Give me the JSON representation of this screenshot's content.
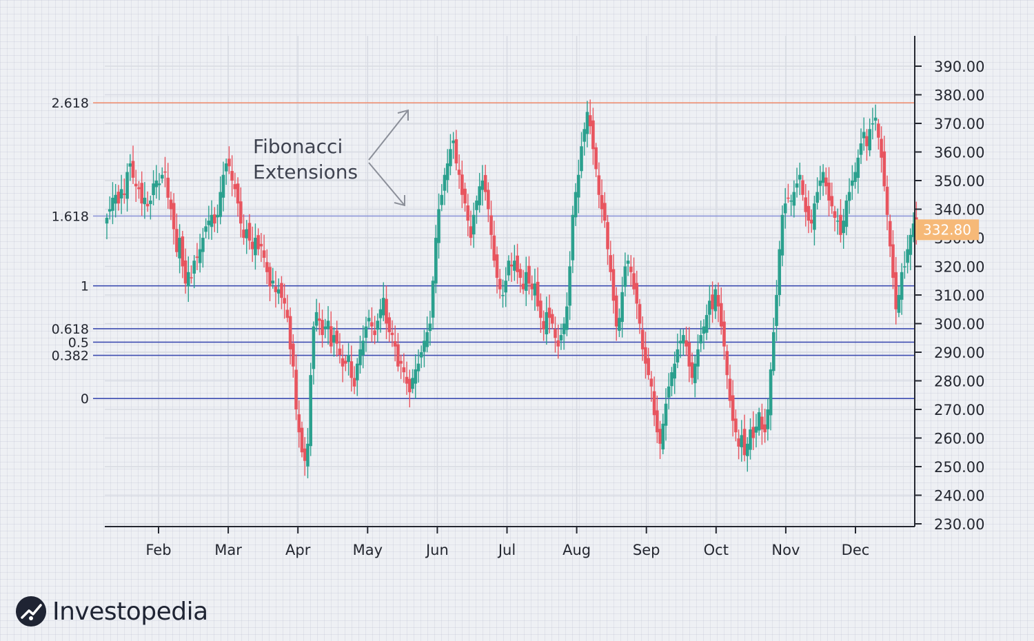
{
  "chart_data": {
    "type": "candlestick",
    "months": [
      "Feb",
      "Mar",
      "Apr",
      "May",
      "Jun",
      "Jul",
      "Aug",
      "Sep",
      "Oct",
      "Nov",
      "Dec"
    ],
    "yticks": [
      "390.00",
      "380.00",
      "370.00",
      "360.00",
      "350.00",
      "340.00",
      "330.00",
      "320.00",
      "310.00",
      "300.00",
      "290.00",
      "280.00",
      "270.00",
      "260.00",
      "250.00",
      "240.00",
      "230.00"
    ],
    "ylim": [
      228,
      395
    ],
    "last_price": "332.80",
    "last_price_value": 332.8,
    "fib_levels": [
      {
        "label": "2.618",
        "value": 377.2,
        "color": "#f0896a"
      },
      {
        "label": "1.618",
        "value": 337.6,
        "color": "#8c95d8"
      },
      {
        "label": "1",
        "value": 313.2,
        "color": "#3c4bb0"
      },
      {
        "label": "0.618",
        "value": 298.2,
        "color": "#3c4bb0"
      },
      {
        "label": "0.5",
        "value": 293.5,
        "color": "#3c4bb0"
      },
      {
        "label": "0.382",
        "value": 288.9,
        "color": "#3c4bb0"
      },
      {
        "label": "0",
        "value": 273.8,
        "color": "#3c4bb0"
      }
    ],
    "annotation": [
      "Fibonacci",
      "Extensions"
    ],
    "colors": {
      "up": "#2ba08e",
      "down": "#e8555f",
      "price_tag": "#f6b978",
      "axis": "#23262f",
      "grid": "#d7dae2"
    },
    "closes": [
      [
        0,
        337
      ],
      [
        3,
        340
      ],
      [
        6,
        344
      ],
      [
        9,
        345
      ],
      [
        12,
        342
      ],
      [
        15,
        347
      ],
      [
        18,
        345
      ],
      [
        21,
        353
      ],
      [
        24,
        356
      ],
      [
        27,
        351
      ],
      [
        30,
        348
      ],
      [
        33,
        347
      ],
      [
        36,
        342
      ],
      [
        39,
        344
      ],
      [
        42,
        341
      ],
      [
        45,
        343
      ],
      [
        48,
        349
      ],
      [
        51,
        350
      ],
      [
        54,
        349
      ],
      [
        57,
        352
      ],
      [
        60,
        353
      ],
      [
        63,
        344
      ],
      [
        66,
        340
      ],
      [
        69,
        333
      ],
      [
        72,
        325
      ],
      [
        75,
        330
      ],
      [
        78,
        320
      ],
      [
        81,
        314
      ],
      [
        84,
        318
      ],
      [
        87,
        316
      ],
      [
        90,
        322
      ],
      [
        93,
        323
      ],
      [
        96,
        326
      ],
      [
        99,
        330
      ],
      [
        102,
        334
      ],
      [
        105,
        336
      ],
      [
        108,
        338
      ],
      [
        111,
        335
      ],
      [
        114,
        338
      ],
      [
        117,
        346
      ],
      [
        120,
        352
      ],
      [
        123,
        356
      ],
      [
        126,
        355
      ],
      [
        129,
        350
      ],
      [
        132,
        347
      ],
      [
        135,
        342
      ],
      [
        138,
        335
      ],
      [
        141,
        330
      ],
      [
        144,
        333
      ],
      [
        147,
        329
      ],
      [
        150,
        326
      ],
      [
        153,
        330
      ],
      [
        156,
        326
      ],
      [
        159,
        327
      ],
      [
        162,
        323
      ],
      [
        165,
        318
      ],
      [
        168,
        313
      ],
      [
        171,
        315
      ],
      [
        174,
        311
      ],
      [
        177,
        312
      ],
      [
        180,
        309
      ],
      [
        183,
        307
      ],
      [
        186,
        302
      ],
      [
        189,
        291
      ],
      [
        192,
        285
      ],
      [
        195,
        270
      ],
      [
        198,
        262
      ],
      [
        201,
        255
      ],
      [
        204,
        252
      ],
      [
        207,
        258
      ],
      [
        210,
        282
      ],
      [
        213,
        299
      ],
      [
        216,
        304
      ],
      [
        219,
        301
      ],
      [
        222,
        296
      ],
      [
        225,
        299
      ],
      [
        228,
        301
      ],
      [
        231,
        292
      ],
      [
        234,
        296
      ],
      [
        237,
        293
      ],
      [
        240,
        289
      ],
      [
        243,
        285
      ],
      [
        246,
        286
      ],
      [
        249,
        289
      ],
      [
        252,
        281
      ],
      [
        255,
        278
      ],
      [
        258,
        286
      ],
      [
        261,
        291
      ],
      [
        264,
        294
      ],
      [
        267,
        299
      ],
      [
        270,
        302
      ],
      [
        273,
        299
      ],
      [
        276,
        296
      ],
      [
        279,
        301
      ],
      [
        282,
        305
      ],
      [
        285,
        309
      ],
      [
        288,
        300
      ],
      [
        291,
        297
      ],
      [
        294,
        296
      ],
      [
        297,
        292
      ],
      [
        300,
        285
      ],
      [
        303,
        286
      ],
      [
        306,
        283
      ],
      [
        309,
        279
      ],
      [
        312,
        276
      ],
      [
        315,
        281
      ],
      [
        318,
        284
      ],
      [
        321,
        286
      ],
      [
        324,
        290
      ],
      [
        327,
        294
      ],
      [
        330,
        297
      ],
      [
        333,
        300
      ],
      [
        336,
        315
      ],
      [
        339,
        330
      ],
      [
        342,
        340
      ],
      [
        345,
        345
      ],
      [
        348,
        352
      ],
      [
        351,
        356
      ],
      [
        354,
        361
      ],
      [
        357,
        364
      ],
      [
        360,
        356
      ],
      [
        363,
        352
      ],
      [
        366,
        345
      ],
      [
        369,
        342
      ],
      [
        372,
        336
      ],
      [
        375,
        330
      ],
      [
        378,
        338
      ],
      [
        381,
        343
      ],
      [
        384,
        348
      ],
      [
        387,
        350
      ],
      [
        390,
        346
      ],
      [
        393,
        340
      ],
      [
        396,
        331
      ],
      [
        399,
        322
      ],
      [
        402,
        316
      ],
      [
        405,
        312
      ],
      [
        408,
        310
      ],
      [
        411,
        315
      ],
      [
        414,
        322
      ],
      [
        417,
        320
      ],
      [
        420,
        322
      ],
      [
        423,
        318
      ],
      [
        426,
        316
      ],
      [
        429,
        312
      ],
      [
        432,
        318
      ],
      [
        435,
        314
      ],
      [
        438,
        312
      ],
      [
        441,
        314
      ],
      [
        444,
        306
      ],
      [
        447,
        302
      ],
      [
        450,
        298
      ],
      [
        453,
        304
      ],
      [
        456,
        302
      ],
      [
        459,
        300
      ],
      [
        462,
        295
      ],
      [
        465,
        292
      ],
      [
        468,
        296
      ],
      [
        471,
        300
      ],
      [
        474,
        306
      ],
      [
        477,
        320
      ],
      [
        480,
        338
      ],
      [
        483,
        346
      ],
      [
        486,
        352
      ],
      [
        489,
        362
      ],
      [
        492,
        368
      ],
      [
        495,
        374
      ],
      [
        498,
        369
      ],
      [
        501,
        361
      ],
      [
        504,
        354
      ],
      [
        507,
        345
      ],
      [
        510,
        340
      ],
      [
        513,
        336
      ],
      [
        516,
        326
      ],
      [
        519,
        318
      ],
      [
        522,
        308
      ],
      [
        525,
        299
      ],
      [
        528,
        302
      ],
      [
        531,
        311
      ],
      [
        534,
        320
      ],
      [
        537,
        322
      ],
      [
        540,
        318
      ],
      [
        543,
        312
      ],
      [
        546,
        307
      ],
      [
        549,
        300
      ],
      [
        552,
        291
      ],
      [
        555,
        286
      ],
      [
        558,
        282
      ],
      [
        561,
        278
      ],
      [
        564,
        268
      ],
      [
        567,
        262
      ],
      [
        570,
        258
      ],
      [
        573,
        265
      ],
      [
        576,
        272
      ],
      [
        579,
        278
      ],
      [
        582,
        283
      ],
      [
        585,
        286
      ],
      [
        588,
        291
      ],
      [
        591,
        294
      ],
      [
        594,
        296
      ],
      [
        597,
        292
      ],
      [
        600,
        285
      ],
      [
        603,
        281
      ],
      [
        606,
        286
      ],
      [
        609,
        291
      ],
      [
        612,
        296
      ],
      [
        615,
        299
      ],
      [
        618,
        303
      ],
      [
        621,
        308
      ],
      [
        624,
        305
      ],
      [
        627,
        312
      ],
      [
        630,
        306
      ],
      [
        633,
        299
      ],
      [
        636,
        292
      ],
      [
        639,
        282
      ],
      [
        642,
        273
      ],
      [
        645,
        266
      ],
      [
        648,
        262
      ],
      [
        651,
        257
      ],
      [
        654,
        261
      ],
      [
        657,
        254
      ],
      [
        660,
        258
      ],
      [
        663,
        263
      ],
      [
        666,
        260
      ],
      [
        669,
        264
      ],
      [
        672,
        269
      ],
      [
        675,
        263
      ],
      [
        678,
        262
      ],
      [
        681,
        270
      ],
      [
        684,
        284
      ],
      [
        687,
        297
      ],
      [
        690,
        310
      ],
      [
        693,
        326
      ],
      [
        696,
        338
      ],
      [
        699,
        342
      ],
      [
        702,
        344
      ],
      [
        705,
        343
      ],
      [
        708,
        346
      ],
      [
        711,
        349
      ],
      [
        714,
        352
      ],
      [
        717,
        345
      ],
      [
        720,
        339
      ],
      [
        723,
        336
      ],
      [
        726,
        335
      ],
      [
        729,
        342
      ],
      [
        732,
        346
      ],
      [
        735,
        350
      ],
      [
        738,
        353
      ],
      [
        741,
        348
      ],
      [
        744,
        343
      ],
      [
        747,
        341
      ],
      [
        750,
        337
      ],
      [
        753,
        336
      ],
      [
        756,
        331
      ],
      [
        759,
        336
      ],
      [
        762,
        343
      ],
      [
        765,
        346
      ],
      [
        768,
        350
      ],
      [
        771,
        353
      ],
      [
        774,
        358
      ],
      [
        777,
        363
      ],
      [
        780,
        367
      ],
      [
        783,
        362
      ],
      [
        786,
        368
      ],
      [
        789,
        370
      ],
      [
        792,
        372
      ],
      [
        795,
        365
      ],
      [
        798,
        358
      ],
      [
        801,
        348
      ],
      [
        804,
        338
      ],
      [
        807,
        327
      ],
      [
        810,
        316
      ],
      [
        813,
        305
      ],
      [
        816,
        310
      ],
      [
        819,
        318
      ],
      [
        822,
        320
      ],
      [
        825,
        326
      ],
      [
        828,
        331
      ],
      [
        831,
        335
      ],
      [
        834,
        332.8
      ]
    ]
  }
}
